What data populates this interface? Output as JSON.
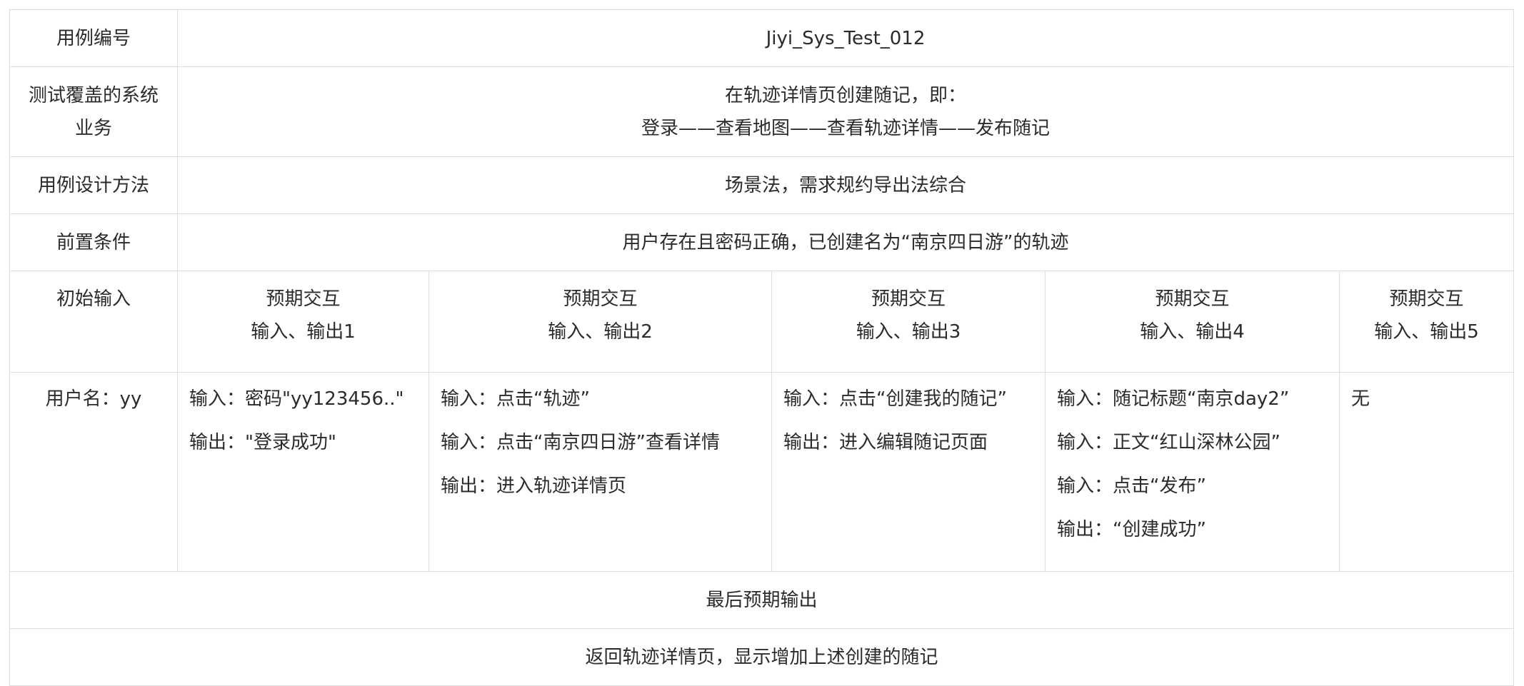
{
  "rows": {
    "case_id": {
      "label": "用例编号",
      "value": "Jiyi_Sys_Test_012"
    },
    "coverage": {
      "label_lines": [
        "测试覆盖的系统",
        "业务"
      ],
      "value_lines": [
        "在轨迹详情页创建随记，即：",
        "登录——查看地图——查看轨迹详情——发布随记"
      ]
    },
    "method": {
      "label": "用例设计方法",
      "value": "场景法，需求规约导出法综合"
    },
    "precondition": {
      "label": "前置条件",
      "value": "用户存在且密码正确，已创建名为“南京四日游”的轨迹"
    },
    "initial_input": {
      "label": "初始输入",
      "value": "用户名：yy"
    },
    "final_output_header": "最后预期输出",
    "final_output_value": "返回轨迹详情页，显示增加上述创建的随记"
  },
  "steps": [
    {
      "header": [
        "预期交互",
        "输入、输出1"
      ],
      "lines": [
        "输入：密码\"yy123456..\"",
        "输出：\"登录成功\""
      ]
    },
    {
      "header": [
        "预期交互",
        "输入、输出2"
      ],
      "lines": [
        "输入：点击“轨迹”",
        "输入：点击“南京四日游”查看详情",
        "输出：进入轨迹详情页"
      ]
    },
    {
      "header": [
        "预期交互",
        "输入、输出3"
      ],
      "lines": [
        "输入：点击“创建我的随记”",
        "输出：进入编辑随记页面"
      ]
    },
    {
      "header": [
        "预期交互",
        "输入、输出4"
      ],
      "lines": [
        "输入：随记标题“南京day2”",
        "输入：正文“红山深林公园”",
        "输入：点击“发布”",
        "输出：“创建成功”"
      ]
    },
    {
      "header": [
        "预期交互",
        "输入、输出5"
      ],
      "lines": [
        "无"
      ]
    }
  ]
}
